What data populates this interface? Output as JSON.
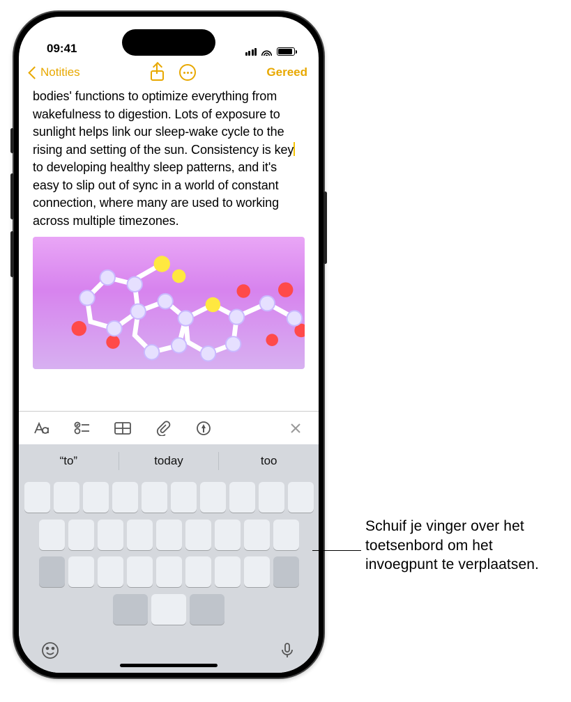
{
  "status": {
    "time": "09:41"
  },
  "nav": {
    "back_label": "Notities",
    "done_label": "Gereed"
  },
  "note": {
    "text_before_cursor": "bodies' functions to optimize everything from wakefulness to digestion. Lots of exposure to sunlight helps link our sleep-wake cycle to the rising and setting of the sun. Consistency is key",
    "text_after_cursor": "to developing healthy sleep patterns, and it's easy to slip out of sync in a world of constant connection, where many are used to working across multiple timezones."
  },
  "suggestions": {
    "left": "“to”",
    "center": "today",
    "right": "too"
  },
  "callout": {
    "text": "Schuif je vinger over het toetsenbord om het invoegpunt te verplaatsen."
  }
}
